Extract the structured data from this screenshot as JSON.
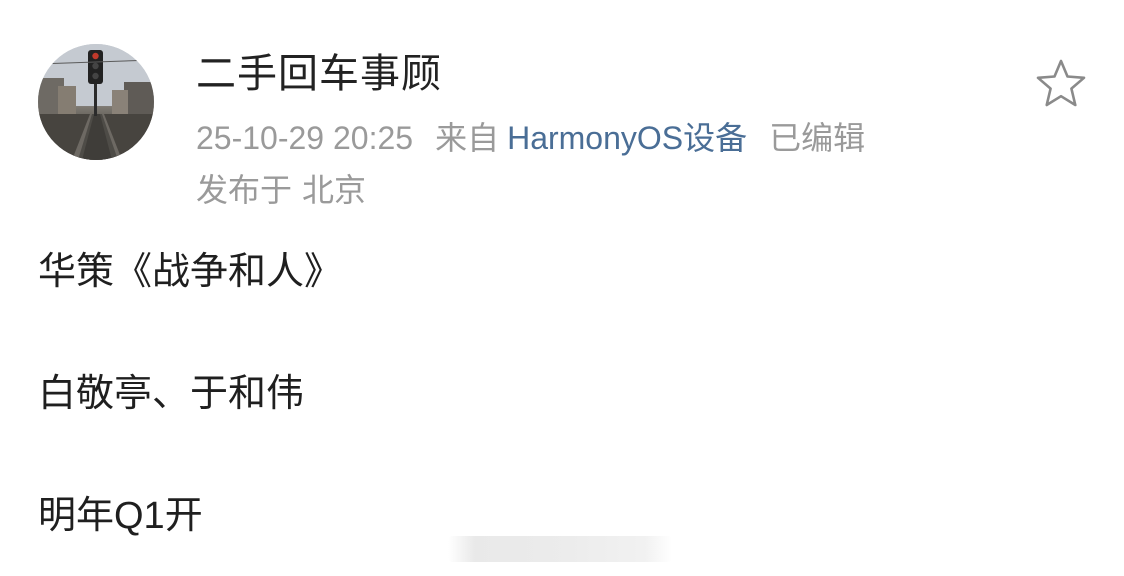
{
  "post": {
    "author": {
      "name": "二手回车事顾",
      "avatar_icon": "railway-signal-avatar"
    },
    "meta": {
      "datetime": "25-10-29 20:25",
      "source_prefix": "来自",
      "device": "HarmonyOS设备",
      "edited": "已编辑",
      "location_prefix": "发布于",
      "location": "北京"
    },
    "favorite_icon": "star-outline-icon",
    "content": {
      "line1": "华策《战争和人》",
      "line2": "白敬亭、于和伟",
      "line3": "明年Q1开"
    }
  },
  "colors": {
    "meta_gray": "#9a9a9a",
    "device_link": "#4a6e96",
    "text": "#1f1f1f"
  }
}
